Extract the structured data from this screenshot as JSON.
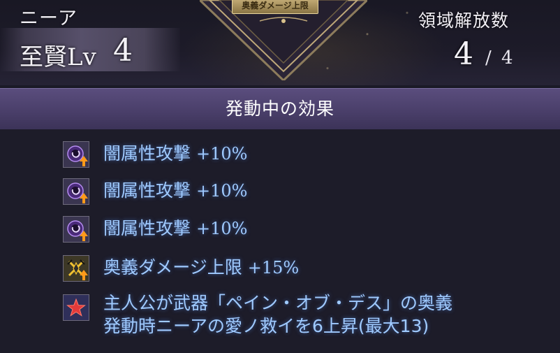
{
  "header": {
    "character_name": "ニーア",
    "level_label": "至賢Lv",
    "level_value": "4",
    "emblem_badge": "奥義ダメージ上限",
    "region_title": "領域解放数",
    "region_current": "4",
    "region_separator": "/",
    "region_max": "4"
  },
  "banner": {
    "title": "発動中の効果"
  },
  "effects": [
    {
      "icon": "dark-attack-up-icon",
      "label": "闇属性攻撃",
      "value": "+10%"
    },
    {
      "icon": "dark-attack-up-icon",
      "label": "闇属性攻撃",
      "value": "+10%"
    },
    {
      "icon": "dark-attack-up-icon",
      "label": "闇属性攻撃",
      "value": "+10%"
    },
    {
      "icon": "ougi-damage-cap-up-icon",
      "label": "奥義ダメージ上限",
      "value": "+15%"
    },
    {
      "icon": "star-icon",
      "line1": "主人公が武器「ペイン・オブ・デス」の奥義",
      "line2": "発動時ニーアの愛ノ救イを6上昇(最大13)"
    }
  ],
  "colors": {
    "effect_text": "#9fcaff",
    "banner": "#4a3f6a",
    "background": "#1d1c29"
  }
}
